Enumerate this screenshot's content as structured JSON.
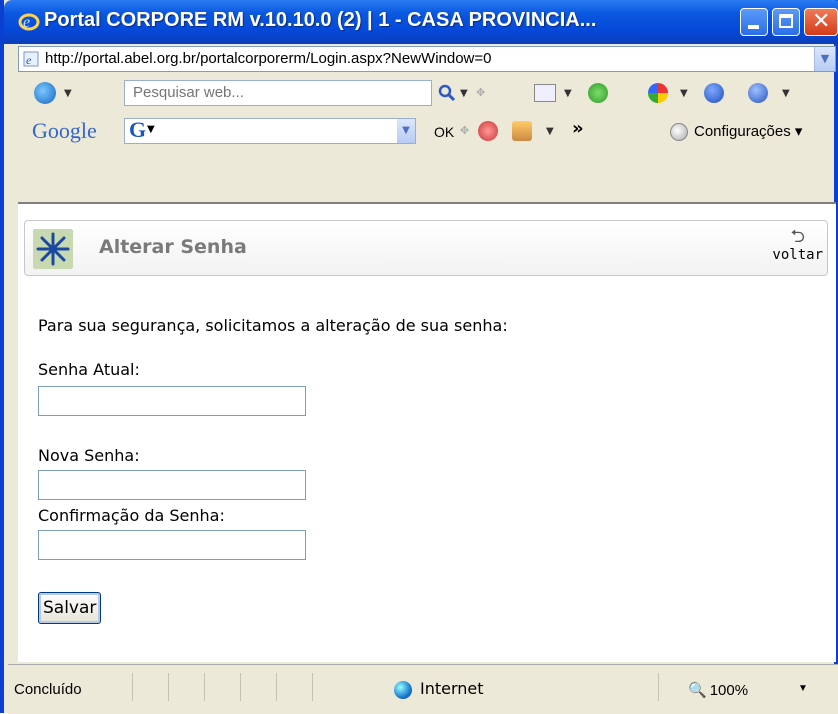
{
  "window": {
    "title": "Portal CORPORE RM v.10.10.0 (2) | 1 - CASA PROVINCIA...",
    "minimize_glyph": "",
    "close_glyph": "✕"
  },
  "address": {
    "url": "http://portal.abel.org.br/portalcorporerm/Login.aspx?NewWindow=0"
  },
  "toolbar1": {
    "search_placeholder": "Pesquisar web..."
  },
  "toolbar2": {
    "google_label": "Google",
    "google_box_letter": "G",
    "ok_label": "OK",
    "more_label": "»",
    "settings_label": "Configurações ▾"
  },
  "panel": {
    "title": "Alterar Senha",
    "back_label": "voltar"
  },
  "form": {
    "intro": "Para sua segurança, solicitamos a alteração de sua senha:",
    "current_label": "Senha Atual:",
    "new_label": "Nova Senha:",
    "confirm_label": "Confirmação da Senha:",
    "save_label": "Salvar"
  },
  "statusbar": {
    "status": "Concluído",
    "zone": "Internet",
    "zoom": "100%"
  },
  "colors": {
    "titlebar": "#0a58e0",
    "panel_title": "#7a7a7a",
    "chrome": "#ece9d8"
  }
}
